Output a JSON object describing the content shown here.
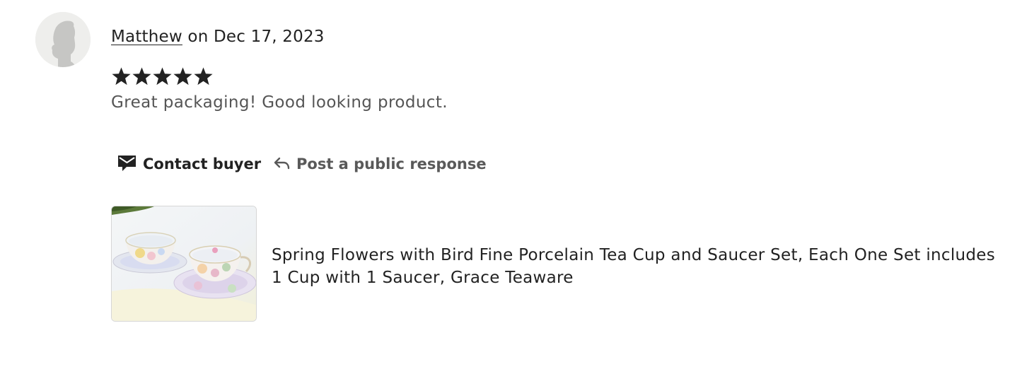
{
  "review": {
    "reviewer_name": "Matthew",
    "date_text": " on Dec 17, 2023",
    "rating": 5,
    "rating_max": 5,
    "text": "Great packaging! Good looking product."
  },
  "actions": {
    "contact_label": "Contact buyer",
    "respond_label": "Post a public response"
  },
  "product": {
    "title": "Spring Flowers with Bird Fine Porcelain Tea Cup and Saucer Set, Each One Set includes 1 Cup with 1 Saucer, Grace Teaware"
  },
  "icons": {
    "avatar": "user-silhouette-icon",
    "star": "star-icon",
    "contact": "envelope-icon",
    "respond": "reply-arrow-icon"
  },
  "colors": {
    "text": "#222222",
    "muted_text": "#555555",
    "star": "#222222",
    "avatar_bg": "#eeeeec"
  }
}
